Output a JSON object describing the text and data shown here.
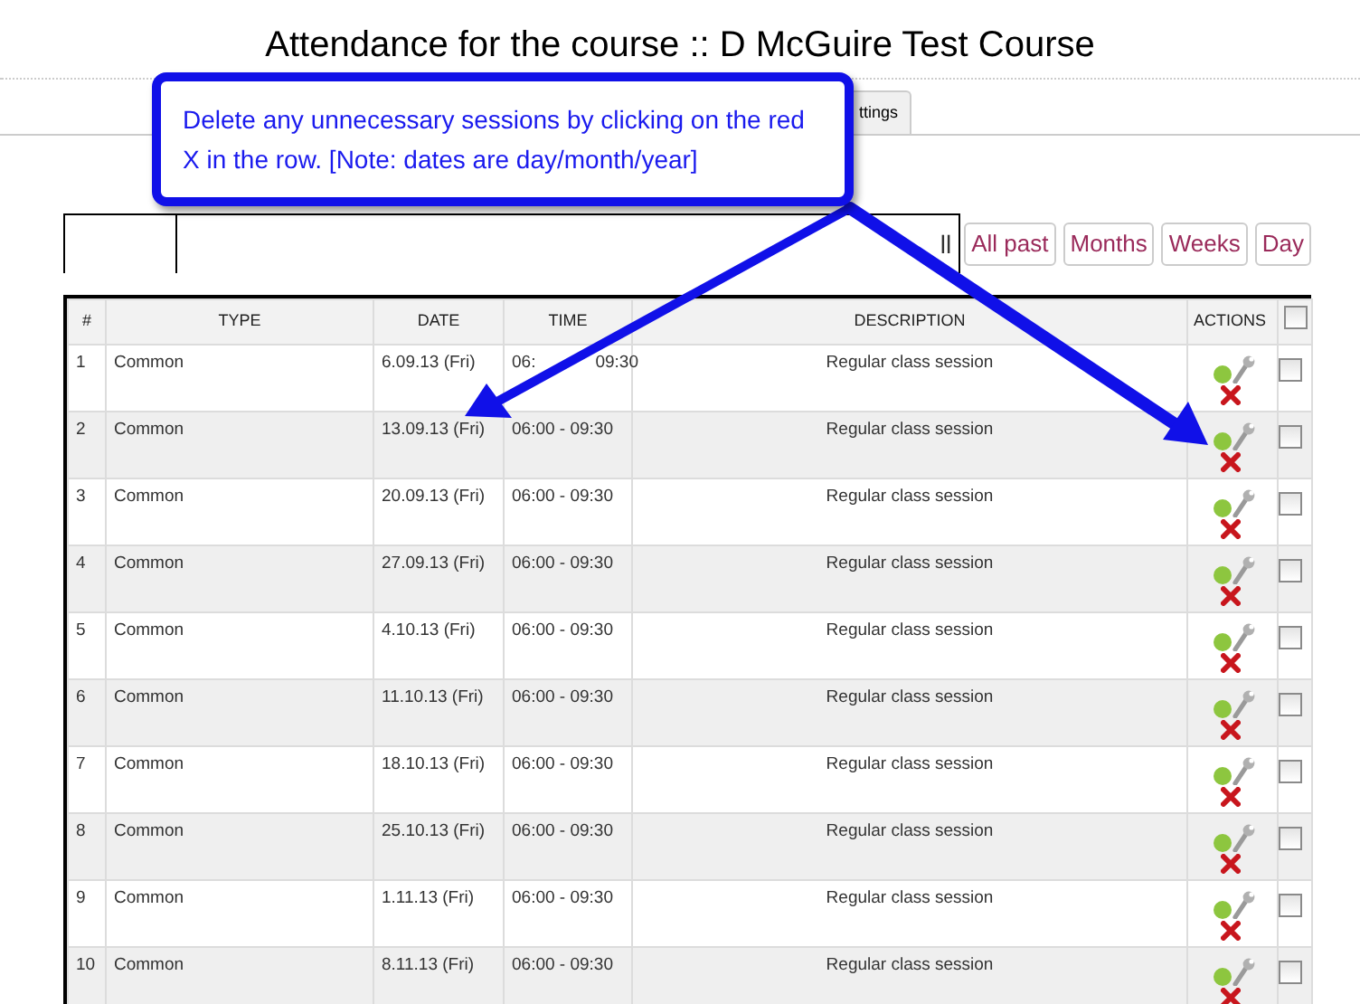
{
  "title": "Attendance for the course :: D McGuire Test Course",
  "tabs": [
    {
      "label": "ttings",
      "selected": false
    }
  ],
  "view_buttons": [
    {
      "label": "ll",
      "selected": false
    },
    {
      "label": "All past",
      "selected": false
    },
    {
      "label": "Months",
      "selected": false
    },
    {
      "label": "Weeks",
      "selected": false
    },
    {
      "label": "Day",
      "selected": false
    }
  ],
  "callout": "Delete any unnecessary sessions by clicking on the red X in the row. [Note: dates are day/month/year]",
  "table": {
    "columns": [
      "#",
      "TYPE",
      "DATE",
      "TIME",
      "DESCRIPTION",
      "ACTIONS"
    ],
    "select_all_checked": false,
    "rows": [
      {
        "n": "1",
        "type": "Common",
        "date": "6.09.13 (Fri)",
        "time_parts": [
          "06:",
          "09:30"
        ],
        "description": "Regular class session",
        "checked": false
      },
      {
        "n": "2",
        "type": "Common",
        "date": "13.09.13 (Fri)",
        "time": "06:00 - 09:30",
        "description": "Regular class session",
        "checked": false
      },
      {
        "n": "3",
        "type": "Common",
        "date": "20.09.13 (Fri)",
        "time": "06:00 - 09:30",
        "description": "Regular class session",
        "checked": false
      },
      {
        "n": "4",
        "type": "Common",
        "date": "27.09.13 (Fri)",
        "time": "06:00 - 09:30",
        "description": "Regular class session",
        "checked": false
      },
      {
        "n": "5",
        "type": "Common",
        "date": "4.10.13 (Fri)",
        "time": "06:00 - 09:30",
        "description": "Regular class session",
        "checked": false
      },
      {
        "n": "6",
        "type": "Common",
        "date": "11.10.13 (Fri)",
        "time": "06:00 - 09:30",
        "description": "Regular class session",
        "checked": false
      },
      {
        "n": "7",
        "type": "Common",
        "date": "18.10.13 (Fri)",
        "time": "06:00 - 09:30",
        "description": "Regular class session",
        "checked": false
      },
      {
        "n": "8",
        "type": "Common",
        "date": "25.10.13 (Fri)",
        "time": "06:00 - 09:30",
        "description": "Regular class session",
        "checked": false
      },
      {
        "n": "9",
        "type": "Common",
        "date": "1.11.13 (Fri)",
        "time": "06:00 - 09:30",
        "description": "Regular class session",
        "checked": false
      },
      {
        "n": "10",
        "type": "Common",
        "date": "8.11.13 (Fri)",
        "time": "06:00 - 09:30",
        "description": "Regular class session",
        "checked": false
      }
    ]
  }
}
